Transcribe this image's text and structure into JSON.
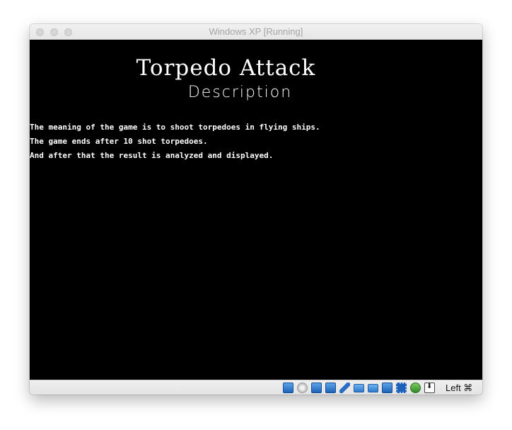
{
  "window": {
    "title": "Windows XP [Running]"
  },
  "game": {
    "title": "Torpedo Attack",
    "subtitle": "Description",
    "lines": [
      "The meaning of the game is to shoot torpedoes in flying ships.",
      "The game ends after 10 shot torpedoes.",
      "And after that the result is analyzed and displayed."
    ]
  },
  "statusbar": {
    "icons": [
      "hard-disk-icon",
      "optical-drive-icon",
      "audio-icon",
      "network-icon",
      "usb-icon",
      "shared-folders-icon",
      "display-icon",
      "video-capture-icon",
      "cpu-icon",
      "mouse-integration-icon",
      "keyboard-capture-icon"
    ],
    "host_key": "Left ⌘"
  },
  "colors": {
    "screen_bg": "#000000",
    "text": "#ffffff",
    "accent": "#1d63b8"
  }
}
